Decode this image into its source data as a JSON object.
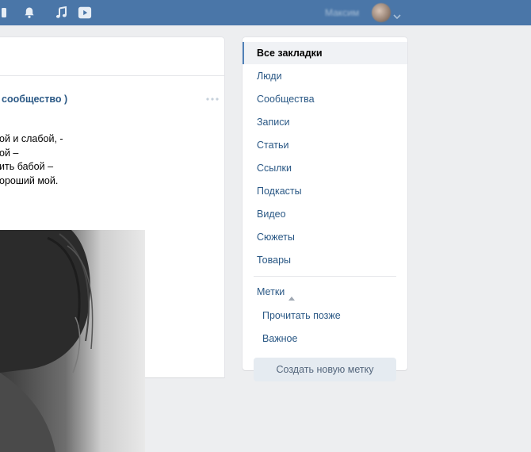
{
  "header": {
    "icons": [
      "bell-icon",
      "music-icon",
      "video-icon"
    ],
    "user_name": "Максим",
    "bar_color": "#4a76a8"
  },
  "post": {
    "author": "сообщество )",
    "text_lines": [
      "ой и слабой, -",
      "ой –",
      "ить бабой –",
      "орoший мой."
    ],
    "photo": "black-and-white-photo-woman-curly-hair"
  },
  "bookmarks_menu": {
    "items": [
      {
        "label": "Все закладки",
        "active": true
      },
      {
        "label": "Люди",
        "active": false
      },
      {
        "label": "Сообщества",
        "active": false
      },
      {
        "label": "Записи",
        "active": false
      },
      {
        "label": "Статьи",
        "active": false
      },
      {
        "label": "Ссылки",
        "active": false
      },
      {
        "label": "Подкасты",
        "active": false
      },
      {
        "label": "Видео",
        "active": false
      },
      {
        "label": "Сюжеты",
        "active": false
      },
      {
        "label": "Товары",
        "active": false
      }
    ],
    "tags_label": "Метки",
    "tags": [
      "Прочитать позже",
      "Важное"
    ],
    "create_tag_label": "Создать новую метку"
  }
}
